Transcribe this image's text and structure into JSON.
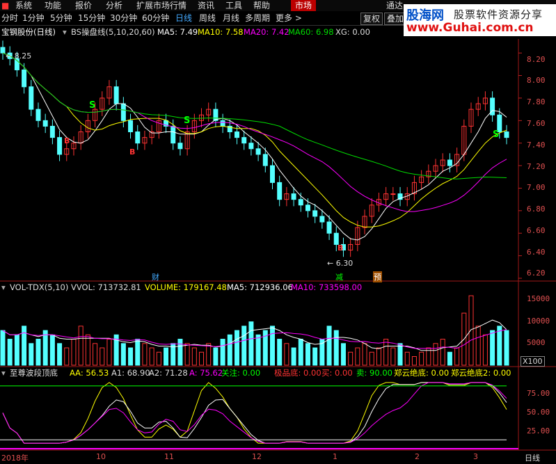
{
  "menu": [
    "系统",
    "功能",
    "报价",
    "分析",
    "扩展市场行情",
    "资讯",
    "工具",
    "帮助"
  ],
  "menu_tab": "市场",
  "menu_right": "通达",
  "periods": [
    "分时",
    "1分钟",
    "5分钟",
    "15分钟",
    "30分钟",
    "60分钟",
    "日线",
    "周线",
    "月线",
    "多周期",
    "更多 >"
  ],
  "active_period": "日线",
  "right_buttons": [
    "复权",
    "叠加"
  ],
  "logo": {
    "cn": "股海网",
    "tag": "股票软件资源分享",
    "url": "www.Guhai.com.cn"
  },
  "main_legend": {
    "stock": "宝钢股份(日线)",
    "indicator": "BS操盘线(5,10,20,60)",
    "ma5": "MA5: 7.49",
    "ma10": "MA10: 7.58",
    "ma20": "MA20: 7.42",
    "ma60": "MA60: 6.98",
    "xg": "XG: 0.00"
  },
  "price_axis": [
    "8.20",
    "8.00",
    "7.80",
    "7.60",
    "7.40",
    "7.20",
    "7.00",
    "6.80",
    "6.60",
    "6.40",
    "6.20"
  ],
  "annotations": {
    "high": "8.25",
    "low": "6.30",
    "cai": "财",
    "jian": "减",
    "yu": "预",
    "s": "S",
    "b": "B"
  },
  "vol_legend": {
    "name": "VOL-TDX(5,10)",
    "vvol": "VVOL: 713732.81",
    "volume": "VOLUME: 179167.48",
    "ma5": "MA5: 712936.06",
    "ma10": "MA10: 733598.00"
  },
  "vol_axis": [
    "15000",
    "10000",
    "5000"
  ],
  "vol_unit": "X100",
  "osc_legend": {
    "name": "至尊波段顶底",
    "aa": "AA: 56.53",
    "a1": "A1: 68.90",
    "a2": "A2: 71.28",
    "a": "A: 75.62",
    "gz": "关注: 0.00",
    "jpd": "极品底: 0.00",
    "buy": "买: 0.00",
    "sell": "卖: 90.00",
    "zy": "郑云绝底: 0.00",
    "zy2": "郑云绝底2: 0.00"
  },
  "osc_axis": [
    "75.00",
    "50.00",
    "25.00"
  ],
  "x_axis": [
    "2018年",
    "10",
    "11",
    "12",
    "1",
    "2",
    "3"
  ],
  "bottom_tab": "日线",
  "colors": {
    "up": "#ff3333",
    "down": "#54ffff",
    "ma5": "#ffffff",
    "ma10": "#ffff00",
    "ma20": "#ff00ff",
    "ma60": "#00dd00",
    "axis": "#c02020"
  },
  "chart_data": {
    "type": "candlestick",
    "closes": [
      8.2,
      8.15,
      8.05,
      7.9,
      7.7,
      7.6,
      7.55,
      7.45,
      7.3,
      7.35,
      7.4,
      7.5,
      7.6,
      7.7,
      7.8,
      7.9,
      7.75,
      7.6,
      7.5,
      7.4,
      7.45,
      7.5,
      7.6,
      7.55,
      7.4,
      7.35,
      7.5,
      7.6,
      7.65,
      7.7,
      7.6,
      7.55,
      7.5,
      7.45,
      7.4,
      7.35,
      7.3,
      7.2,
      7.05,
      6.9,
      6.95,
      6.9,
      6.85,
      6.8,
      6.75,
      6.7,
      6.6,
      6.5,
      6.45,
      6.5,
      6.65,
      6.75,
      6.85,
      6.9,
      6.95,
      6.95,
      6.9,
      6.95,
      7.05,
      7.1,
      7.15,
      7.2,
      7.25,
      7.2,
      7.3,
      7.55,
      7.7,
      7.75,
      7.8,
      7.65,
      7.5,
      7.45
    ],
    "price_range": [
      6.2,
      8.3
    ],
    "volumes": [
      8000,
      6000,
      7000,
      9000,
      5000,
      6000,
      8000,
      7000,
      5000,
      4000,
      6000,
      9000,
      7000,
      5000,
      4000,
      6000,
      7000,
      5000,
      4000,
      6000,
      5000,
      4000,
      3000,
      4000,
      5000,
      6000,
      5000,
      4000,
      3000,
      5000,
      4000,
      6000,
      7000,
      8000,
      9000,
      10000,
      7000,
      8000,
      9000,
      6000,
      5000,
      4000,
      6000,
      5000,
      4000,
      6000,
      9000,
      8000,
      5000,
      3000,
      4000,
      5000,
      3000,
      4000,
      6000,
      4000,
      5000,
      3000,
      2000,
      3000,
      4000,
      5000,
      6000,
      3000,
      4000,
      12000,
      16000,
      9000,
      7000,
      8000,
      9000,
      8000
    ],
    "volume_range": [
      0,
      16500
    ],
    "osc_range": [
      0,
      100
    ]
  }
}
